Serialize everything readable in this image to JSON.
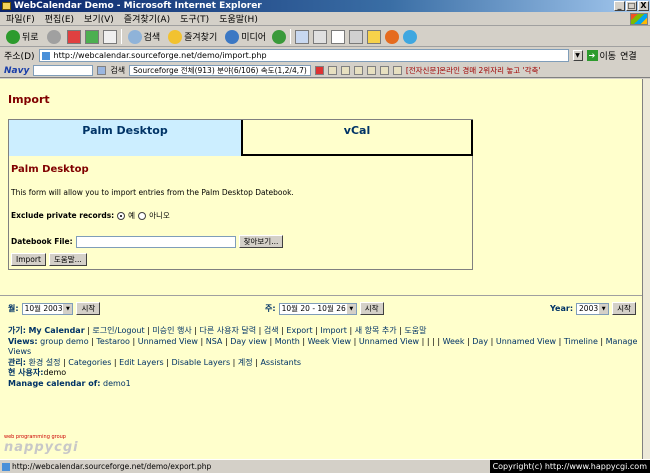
{
  "window": {
    "title": "WebCalendar Demo - Microsoft Internet Explorer",
    "buttons": {
      "minimize": "_",
      "maximize": "□",
      "close": "X"
    }
  },
  "menu": [
    "파일(F)",
    "편집(E)",
    "보기(V)",
    "즐겨찾기(A)",
    "도구(T)",
    "도움말(H)"
  ],
  "toolbar": {
    "back": "뒤로",
    "search": "검색",
    "favorites": "즐겨찾기",
    "media": "미디어"
  },
  "address": {
    "label": "주소(D)",
    "url": "http://webcalendar.sourceforge.net/demo/import.php",
    "go": "이동",
    "links": "연결"
  },
  "navy": {
    "logo": "Navy",
    "search_btn": "검색",
    "status": "Sourceforge   전체(913)   분야(6/106)   속도(1,2/4,7)",
    "ticker": "[전자신문]온라인 경매 2위자리 놓고 '각축'"
  },
  "page": {
    "title": "Import",
    "tabs": [
      "Palm Desktop",
      "vCal"
    ],
    "section_title": "Palm Desktop",
    "description": "This form will allow you to import entries from the Palm Desktop Datebook.",
    "exclude_label": "Exclude private records:",
    "radio_yes": "예",
    "radio_no": "아니오",
    "file_label": "Datebook File:",
    "browse": "찾아보기...",
    "import_btn": "Import",
    "help_btn": "도움말..."
  },
  "nav": {
    "month_label": "월:",
    "month_value": "10월 2003",
    "week_label": "주:",
    "week_value": "10월 20 - 10월 26",
    "year_label": "Year:",
    "year_value": "2003",
    "go": "시작"
  },
  "links": {
    "goto_label": "가기:",
    "goto_items": [
      "My Calendar",
      "로그인/Logout",
      "미승인 행사",
      "다른 사용자 달력",
      "검색",
      "Export",
      "Import",
      "새 항목 추가",
      "도움말"
    ],
    "views_label": "Views:",
    "views_items": [
      "group demo",
      "Testaroo",
      "Unnamed View",
      "NSA",
      "Day view",
      "Month",
      "Week View",
      "Unnamed View",
      "|",
      "|",
      "Week",
      "Day",
      "Unnamed View",
      "Timeline",
      "Manage Views"
    ],
    "admin_label": "관리:",
    "admin_items": [
      "환경 설정",
      "Categories",
      "Edit Layers",
      "Disable Layers",
      "계정",
      "Assistants"
    ],
    "user_label": "현 사용자:",
    "user_value": "demo",
    "manage_label": "Manage calendar of:",
    "manage_value": "demo1"
  },
  "footer": {
    "logo_small": "web programming group",
    "logo_main": "nappycgi",
    "status_url": "http://webcalendar.sourceforge.net/demo/export.php",
    "copyright": "Copyright(c) http://www.happycgi.com"
  },
  "colors": {
    "accent": "#800000",
    "link": "#003366",
    "content_bg": "#ffffcc",
    "tab_active": "#cceeff"
  }
}
